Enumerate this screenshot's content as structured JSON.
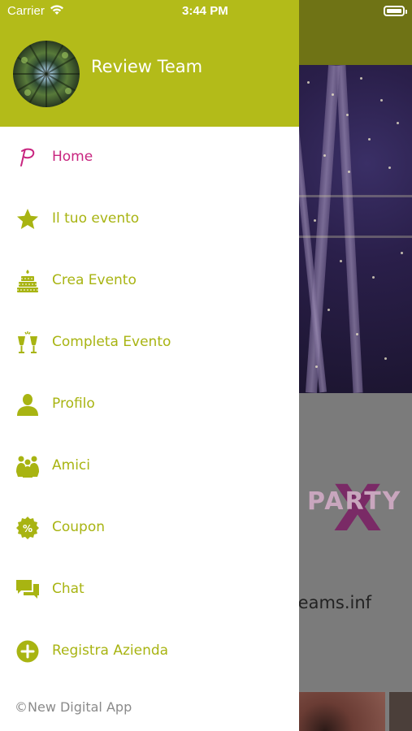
{
  "status_bar": {
    "carrier": "Carrier",
    "time": "3:44 PM"
  },
  "drawer": {
    "user_name": "Review Team",
    "menu": [
      {
        "label": "Home",
        "icon": "brand-p-icon",
        "active": true
      },
      {
        "label": "Il tuo evento",
        "icon": "star-icon",
        "active": false
      },
      {
        "label": "Crea Evento",
        "icon": "cake-icon",
        "active": false
      },
      {
        "label": "Completa Evento",
        "icon": "toast-glasses-icon",
        "active": false
      },
      {
        "label": "Profilo",
        "icon": "person-icon",
        "active": false
      },
      {
        "label": "Amici",
        "icon": "friends-icon",
        "active": false
      },
      {
        "label": "Coupon",
        "icon": "coupon-icon",
        "active": false
      },
      {
        "label": "Chat",
        "icon": "chat-icon",
        "active": false
      },
      {
        "label": "Registra Azienda",
        "icon": "add-circle-icon",
        "active": false
      }
    ],
    "copyright": "©New Digital App"
  },
  "background": {
    "logo_text": "PARTY",
    "logo_mark": "X",
    "url_fragment": "etdreams.inf"
  },
  "colors": {
    "accent": "#b3bb19",
    "menu_text": "#a8b412",
    "active": "#c8247f"
  }
}
